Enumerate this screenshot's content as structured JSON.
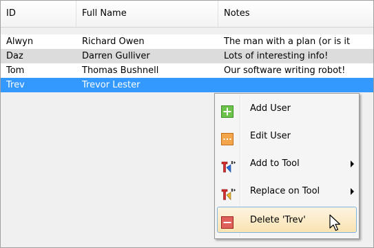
{
  "columns": [
    "ID",
    "Full Name",
    "Notes"
  ],
  "rows": [
    {
      "id": "Alwyn",
      "name": "Richard Owen",
      "notes": "The man with a plan (or is it"
    },
    {
      "id": "Daz",
      "name": "Darren Gulliver",
      "notes": "Lots of interesting info!"
    },
    {
      "id": "Tom",
      "name": "Thomas Bushnell",
      "notes": "Our software writing robot!"
    },
    {
      "id": "Trev",
      "name": "Trevor Lester",
      "notes": ""
    }
  ],
  "selected_row_index": 3,
  "context_menu": {
    "items": [
      {
        "label": "Add User",
        "icon": "add-user-icon",
        "submenu": false
      },
      {
        "label": "Edit User",
        "icon": "edit-user-icon",
        "submenu": false
      },
      {
        "label": "Add to Tool",
        "icon": "tool-icon",
        "submenu": true
      },
      {
        "label": "Replace on Tool",
        "icon": "tool-icon",
        "submenu": true
      },
      {
        "label": "Delete 'Trev'",
        "icon": "delete-user-icon",
        "submenu": false,
        "hovered": true
      }
    ]
  },
  "colors": {
    "selection": "#3399ff",
    "add_icon": "#4caf35",
    "edit_icon": "#e8922e",
    "delete_icon": "#d9534f",
    "menu_hover": "#f9e3b1"
  }
}
